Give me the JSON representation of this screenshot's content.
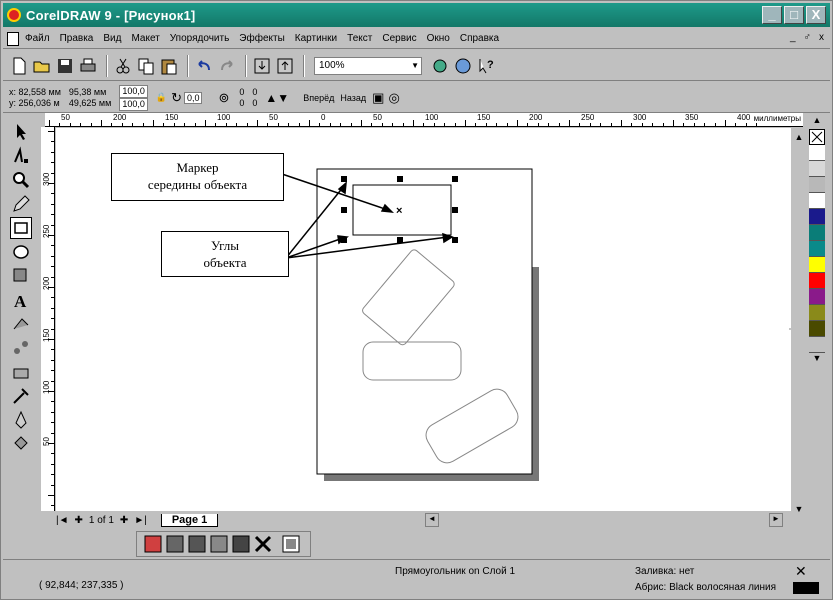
{
  "window": {
    "title": "CorelDRAW 9 - [Рисунок1]",
    "buttons": {
      "minimize": "_",
      "maximize": "□",
      "close": "X"
    }
  },
  "menu": {
    "items": [
      "Файл",
      "Правка",
      "Вид",
      "Макет",
      "Упорядочить",
      "Эффекты",
      "Картинки",
      "Текст",
      "Сервис",
      "Окно",
      "Справка"
    ],
    "right": [
      "_",
      "♂",
      "x"
    ]
  },
  "toolbar": {
    "zoom_value": "100%"
  },
  "properties": {
    "x": "x: 82,558 мм",
    "y": "y: 256,036 м",
    "width": "95,38 мм",
    "height": "49,625 мм",
    "scale_x": "100,0",
    "scale_y": "100,0",
    "rotation": "0,0",
    "corner1": "0",
    "corner2": "0",
    "corner3": "0",
    "corner4": "0",
    "forward_label": "Вперёд",
    "back_label": "Назад"
  },
  "ruler": {
    "units": "миллиметры",
    "h_labels": [
      "50",
      "200",
      "150",
      "100",
      "50",
      "0",
      "50",
      "100",
      "150",
      "200",
      "250",
      "300",
      "350",
      "400"
    ],
    "v_labels": [
      "300",
      "250",
      "200",
      "150",
      "100",
      "50"
    ],
    "v_units": "миллиметры"
  },
  "annotations": {
    "midpoint_marker": "Маркер\nсередины объекта",
    "corners": "Углы\nобъекта"
  },
  "pagebar": {
    "page_count": "1 of 1",
    "page_tab": "Page 1"
  },
  "status": {
    "coords": "( 92,844; 237,335 )",
    "object": "Прямоугольник on Слой 1",
    "fill": "Заливка: нет",
    "outline": "Абрис: Black  волосяная линия"
  },
  "palette_colors": [
    "#ffffff",
    "#d8d8d8",
    "#b8b8b8",
    "#ffffff",
    "#1a1a8c",
    "#0a7d78",
    "#0a8a8a",
    "#ffff00",
    "#ff0000",
    "#8a1a8a",
    "#8a8a1a",
    "#4a4a00",
    "#c0c0c0"
  ],
  "colors": {
    "title_bg": "#137868",
    "chrome": "#c0c0c0"
  }
}
